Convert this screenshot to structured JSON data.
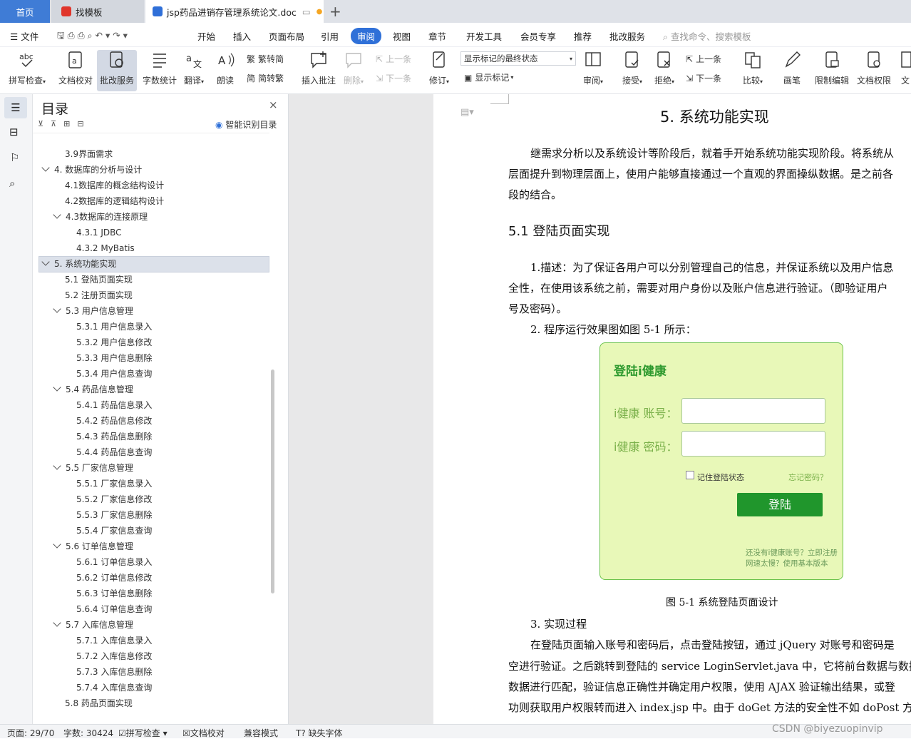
{
  "tabs": {
    "home": "首页",
    "find": "找模板",
    "doc": "jsp药品进销存管理系统论文.doc"
  },
  "menu": {
    "file": "文件",
    "items": [
      "开始",
      "插入",
      "页面布局",
      "引用",
      "审阅",
      "视图",
      "章节",
      "开发工具",
      "会员专享",
      "推荐",
      "批改服务"
    ],
    "search": "查找命令、搜索模板"
  },
  "ribbon": {
    "spell": "拼写检查",
    "check": "文档校对",
    "correct": "批改服务",
    "count": "字数统计",
    "translate": "翻译",
    "read": "朗读",
    "t2s": "繁转简",
    "s2t": "简转繁",
    "comment": "插入批注",
    "delete": "删除",
    "prev": "上一条",
    "next": "下一条",
    "revise": "修订",
    "mode": "显示标记的最终状态",
    "show": "显示标记",
    "review": "审阅",
    "accept": "接受",
    "reject": "拒绝",
    "prev2": "上一条",
    "next2": "下一条",
    "compare": "比较",
    "pen": "画笔",
    "restrict": "限制编辑",
    "rights": "文档权限",
    "cut": "文"
  },
  "toc": {
    "title": "目录",
    "smart": "智能识别目录",
    "items": [
      "3.9界面需求",
      "4. 数据库的分析与设计",
      "4.1数据库的概念结构设计",
      "4.2数据库的逻辑结构设计",
      "4.3数据库的连接原理",
      "4.3.1 JDBC",
      "4.3.2 MyBatis",
      "5. 系统功能实现",
      "5.1 登陆页面实现",
      "5.2 注册页面实现",
      "5.3 用户信息管理",
      "5.3.1 用户信息录入",
      "5.3.2 用户信息修改",
      "5.3.3 用户信息删除",
      "5.3.4 用户信息查询",
      "5.4 药品信息管理",
      "5.4.1 药品信息录入",
      "5.4.2 药品信息修改",
      "5.4.3 药品信息删除",
      "5.4.4 药品信息查询",
      "5.5 厂家信息管理",
      "5.5.1 厂家信息录入",
      "5.5.2 厂家信息修改",
      "5.5.3 厂家信息删除",
      "5.5.4 厂家信息查询",
      "5.6 订单信息管理",
      "5.6.1 订单信息录入",
      "5.6.2 订单信息修改",
      "5.6.3 订单信息删除",
      "5.6.4 订单信息查询",
      "5.7 入库信息管理",
      "5.7.1 入库信息录入",
      "5.7.2 入库信息修改",
      "5.7.3 入库信息删除",
      "5.7.4 入库信息查询",
      "5.8 药品页面实现"
    ]
  },
  "doc": {
    "h1": "5.  系统功能实现",
    "p1a": "继需求分析以及系统设计等阶段后，就着手开始系统功能实现阶段。将系统从",
    "p1b": "层面提升到物理层面上，使用户能够直接通过一个直观的界面操纵数据。是之前各",
    "p1c": "段的结合。",
    "h2": "5.1  登陆页面实现",
    "p2a": "1.描述：为了保证各用户可以分别管理自己的信息，并保证系统以及用户信息",
    "p2b": "全性，在使用该系统之前，需要对用户身份以及账户信息进行验证。（即验证用户",
    "p2c": "号及密码）。",
    "p3": "2.  程序运行效果图如图 5-1 所示：",
    "caption": "图 5-1  系统登陆页面设计",
    "p4": "3.  实现过程",
    "p5a": "在登陆页面输入账号和密码后，点击登陆按钮，通过 jQuery 对账号和密码是",
    "p5b": "空进行验证。之后跳转到登陆的 service LoginServlet.java 中，它将前台数据与数据",
    "p5c": "数据进行匹配，验证信息正确性并确定用户权限，使用 AJAX 验证输出结果，或登",
    "p5d": "功则获取用户权限转而进入 index.jsp 中。由于 doGet 方法的安全性不如 doPost 方"
  },
  "login": {
    "title": "登陆i健康",
    "account": "i健康 账号：",
    "password": "i健康 密码：",
    "remember": "记住登陆状态",
    "forgot": "忘记密码？",
    "submit": "登陆",
    "reg": "还没有i健康账号？立即注册",
    "slow": "网速太慢？使用基本版本"
  },
  "status": {
    "page": "页面: 29/70",
    "words": "字数: 30424",
    "spell": "拼写检查",
    "check": "文档校对",
    "compat": "兼容模式",
    "font": "缺失字体"
  },
  "watermark": "CSDN @biyezuopinvip"
}
